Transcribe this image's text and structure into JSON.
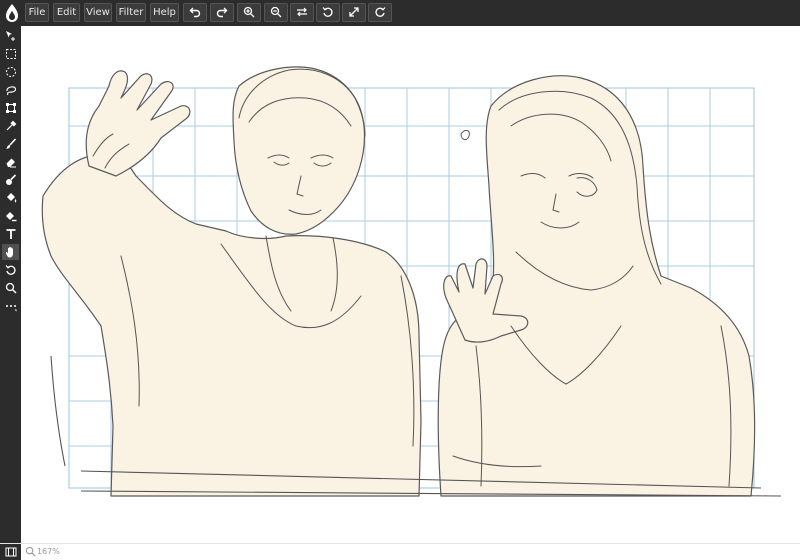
{
  "menu": {
    "file": "File",
    "edit": "Edit",
    "view": "View",
    "filter": "Filter",
    "help": "Help"
  },
  "toolbar_icons": [
    "undo-icon",
    "redo-icon",
    "zoom-in-icon",
    "zoom-out-icon",
    "flip-icon",
    "rotate-left-icon",
    "fullscreen-icon",
    "rotate-right-icon"
  ],
  "tools": [
    "move-icon",
    "rect-select-icon",
    "ellipse-select-icon",
    "lasso-icon",
    "transform-icon",
    "eyedropper-icon",
    "brush-icon",
    "eraser-icon",
    "smudge-icon",
    "fill-icon",
    "gradient-fill-icon",
    "text-icon",
    "hand-icon",
    "rotate-view-icon",
    "zoom-icon",
    "more-icon"
  ],
  "active_tool": "hand-icon",
  "status": {
    "zoom": "167%"
  },
  "colors": {
    "ui_dark": "#2c2c2c",
    "button": "#3c3c3c",
    "skin_fill": "#faf3e4",
    "grid_blue": "#aacde4",
    "sketch_line": "#555555"
  }
}
